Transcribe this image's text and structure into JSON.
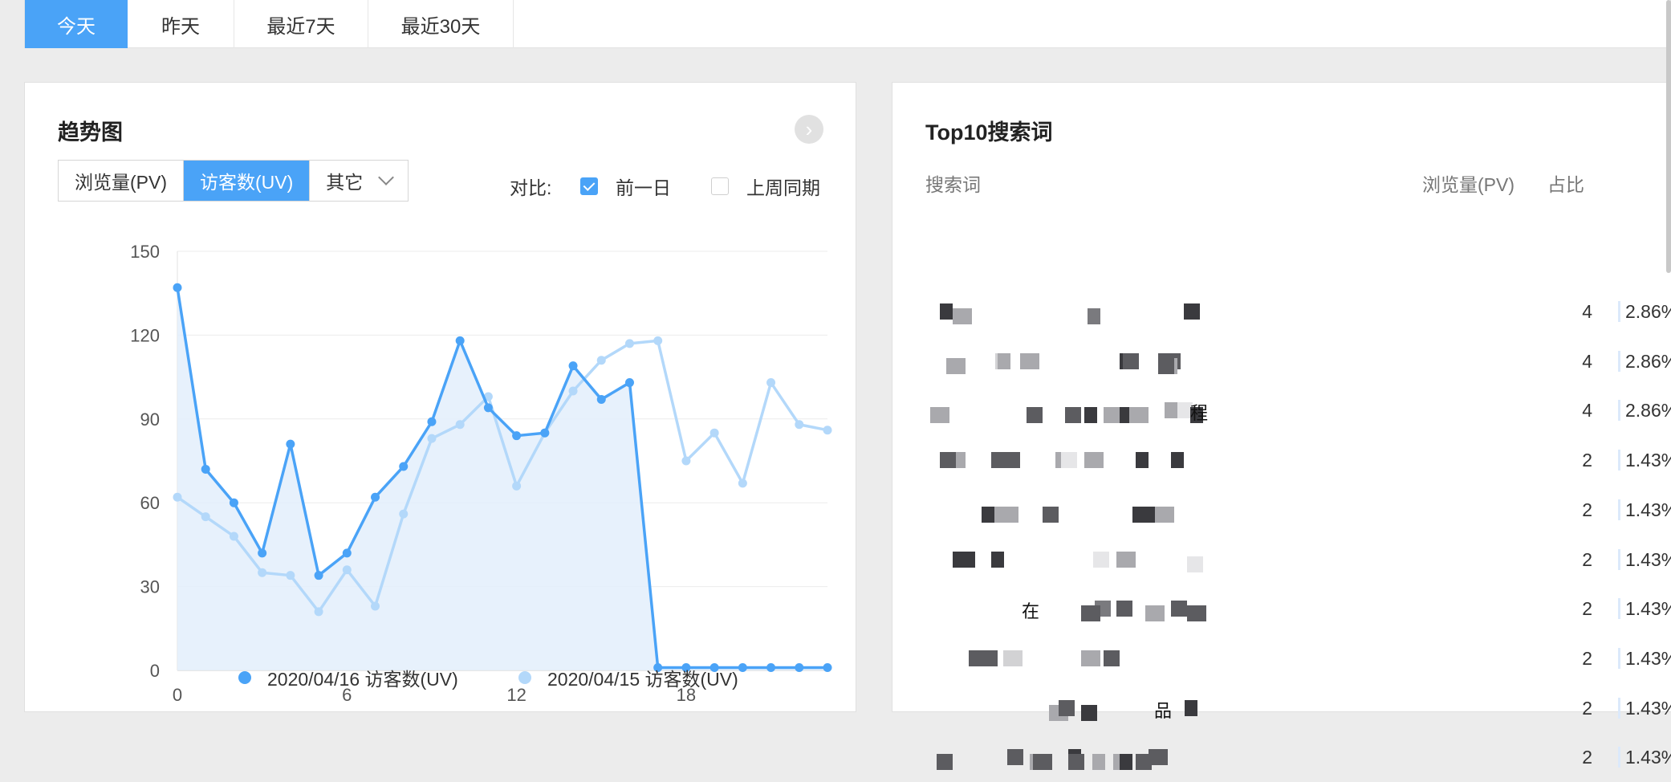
{
  "range_tabs": [
    {
      "label": "今天",
      "active": true
    },
    {
      "label": "昨天",
      "active": false
    },
    {
      "label": "最近7天",
      "active": false
    },
    {
      "label": "最近30天",
      "active": false
    }
  ],
  "trend": {
    "title": "趋势图",
    "next_icon": "chevron-right-icon",
    "metric_tabs": [
      {
        "label": "浏览量(PV)",
        "active": false
      },
      {
        "label": "访客数(UV)",
        "active": true
      },
      {
        "label": "其它",
        "active": false,
        "dropdown": true
      }
    ],
    "compare_label": "对比:",
    "compare_options": [
      {
        "label": "前一日",
        "checked": true
      },
      {
        "label": "上周同期",
        "checked": false
      }
    ]
  },
  "chart_data": {
    "type": "line",
    "x": [
      0,
      1,
      2,
      3,
      4,
      5,
      6,
      7,
      8,
      9,
      10,
      11,
      12,
      13,
      14,
      15,
      16,
      17,
      18,
      19,
      20,
      21,
      22,
      23
    ],
    "x_ticks": [
      0,
      6,
      12,
      18
    ],
    "y_ticks": [
      0,
      30,
      60,
      90,
      120,
      150
    ],
    "ylim": [
      0,
      150
    ],
    "xlim": [
      0,
      23
    ],
    "grid": true,
    "legend_position": "bottom",
    "series": [
      {
        "name": "2020/04/16 访客数(UV)",
        "color": "#4aa3f7",
        "area": true,
        "values": [
          137,
          72,
          60,
          42,
          81,
          34,
          42,
          62,
          73,
          89,
          118,
          94,
          84,
          85,
          109,
          97,
          103,
          1,
          1,
          1,
          1,
          1,
          1,
          1
        ]
      },
      {
        "name": "2020/04/15 访客数(UV)",
        "color": "#b3d8fa",
        "area": false,
        "values": [
          62,
          55,
          48,
          35,
          34,
          21,
          36,
          23,
          56,
          83,
          88,
          98,
          66,
          85,
          100,
          111,
          117,
          118,
          75,
          85,
          67,
          103,
          88,
          86
        ]
      }
    ]
  },
  "search": {
    "title": "Top10搜索词",
    "columns": [
      "搜索词",
      "浏览量(PV)",
      "占比"
    ],
    "rows": [
      {
        "term_visible": "",
        "pv": "4",
        "pct": "2.86%"
      },
      {
        "term_visible": "",
        "pv": "4",
        "pct": "2.86%"
      },
      {
        "term_visible": "程",
        "pv": "4",
        "pct": "2.86%"
      },
      {
        "term_visible": "",
        "pv": "2",
        "pct": "1.43%"
      },
      {
        "term_visible": "",
        "pv": "2",
        "pct": "1.43%"
      },
      {
        "term_visible": "",
        "pv": "2",
        "pct": "1.43%"
      },
      {
        "term_visible": "在",
        "pv": "2",
        "pct": "1.43%"
      },
      {
        "term_visible": "",
        "pv": "2",
        "pct": "1.43%"
      },
      {
        "term_visible": "品",
        "pv": "2",
        "pct": "1.43%"
      },
      {
        "term_visible": "",
        "pv": "2",
        "pct": "1.43%"
      }
    ]
  },
  "colors": {
    "accent": "#4aa3f7",
    "accent_light": "#b3d8fa",
    "area_fill": "#e3effb"
  }
}
